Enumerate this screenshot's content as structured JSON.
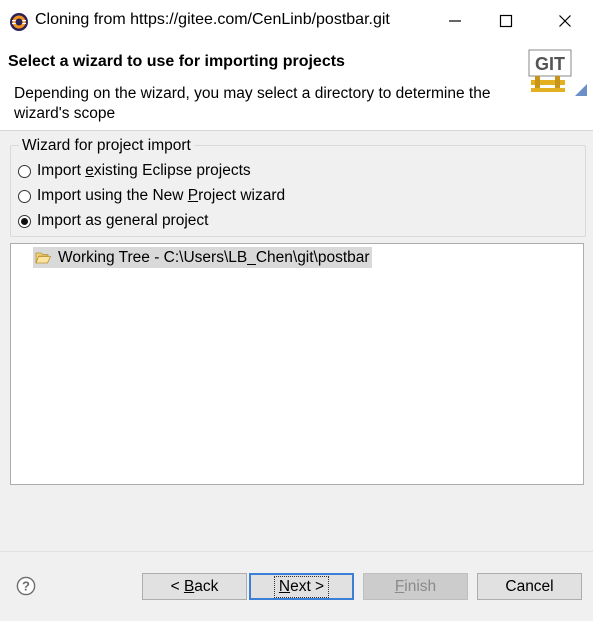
{
  "window": {
    "title": "Cloning from https://gitee.com/CenLinb/postbar.git",
    "controls": {
      "minimize": "minimize",
      "maximize": "maximize",
      "close": "close"
    }
  },
  "header": {
    "title": "Select a wizard to use for importing projects",
    "description": "Depending on the wizard, you may select a directory to determine the wizard's scope",
    "logo_text": "GIT"
  },
  "wizard_group": {
    "title": "Wizard for project import",
    "options": [
      {
        "pre": "Import ",
        "key": "e",
        "post": "xisting Eclipse projects",
        "checked": false
      },
      {
        "pre": "Import using the New ",
        "key": "P",
        "post": "roject wizard",
        "checked": false
      },
      {
        "pre": "Import as ",
        "key": "g",
        "post": "eneral project",
        "checked": true
      }
    ]
  },
  "tree": {
    "items": [
      {
        "label": "Working Tree - C:\\Users\\LB_Chen\\git\\postbar",
        "selected": true
      }
    ]
  },
  "buttons": {
    "back": {
      "pre": "< ",
      "key": "B",
      "post": "ack"
    },
    "next": {
      "pre": "",
      "key": "N",
      "post": "ext >"
    },
    "finish": {
      "pre": "",
      "key": "F",
      "post": "inish"
    },
    "cancel": "Cancel"
  },
  "colors": {
    "accent": "#3c7fd7",
    "selection": "#d9d9d9",
    "background": "#f0f0f0"
  }
}
